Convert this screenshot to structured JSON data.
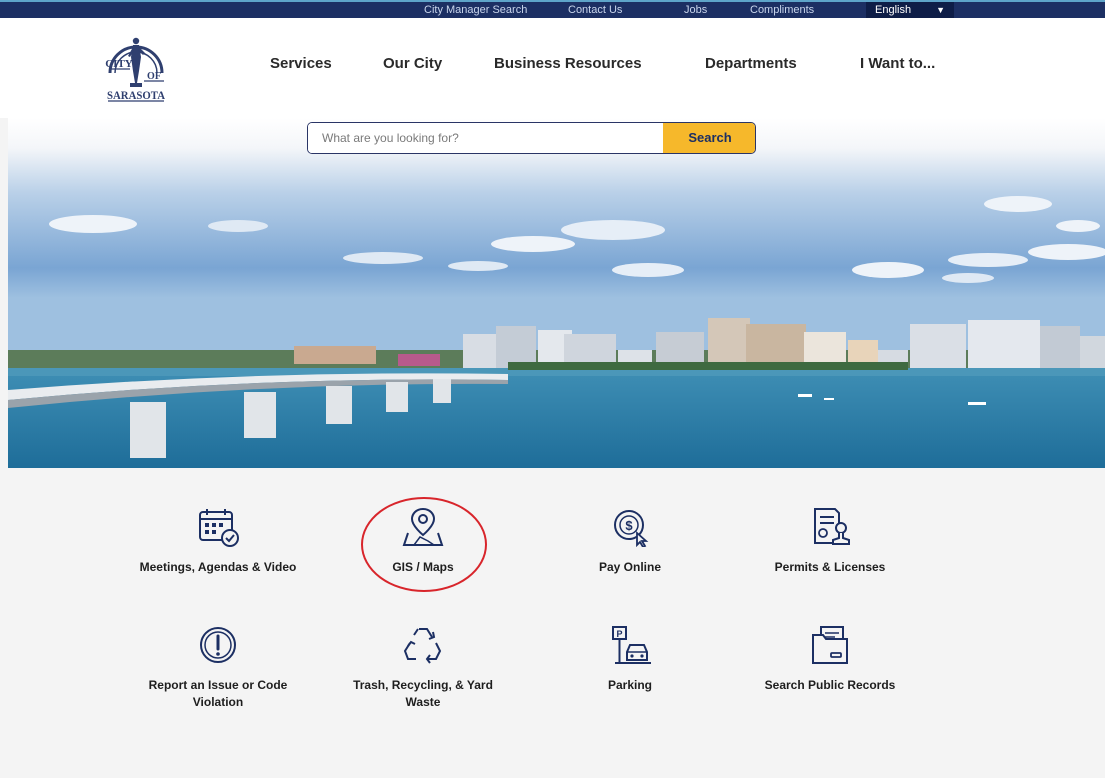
{
  "utility_bar": {
    "links": [
      "City Manager Search",
      "Contact Us",
      "Jobs",
      "Compliments"
    ],
    "language": "English"
  },
  "logo": {
    "top_text": "CITY",
    "right_text": "OF",
    "bottom_text": "SARASOTA"
  },
  "nav": {
    "items": [
      "Services",
      "Our City",
      "Business Resources",
      "Departments",
      "I Want to..."
    ]
  },
  "search": {
    "placeholder": "What are you looking for?",
    "button_label": "Search"
  },
  "quick_links": [
    {
      "label": "Meetings, Agendas & Video",
      "icon": "calendar-check-icon"
    },
    {
      "label": "GIS / Maps",
      "icon": "map-pin-icon",
      "highlighted": true
    },
    {
      "label": "Pay Online",
      "icon": "pay-online-icon"
    },
    {
      "label": "Permits & Licenses",
      "icon": "permit-stamp-icon"
    },
    {
      "label": "Report an Issue or Code Violation",
      "icon": "exclamation-icon"
    },
    {
      "label": "Trash, Recycling, & Yard Waste",
      "icon": "recycle-icon"
    },
    {
      "label": "Parking",
      "icon": "parking-car-icon"
    },
    {
      "label": "Search Public Records",
      "icon": "records-folder-icon"
    }
  ],
  "colors": {
    "navy": "#1c2f63",
    "accent_yellow": "#f6b82b",
    "highlight_red": "#d8252b",
    "icon_stroke": "#1c2f63"
  }
}
